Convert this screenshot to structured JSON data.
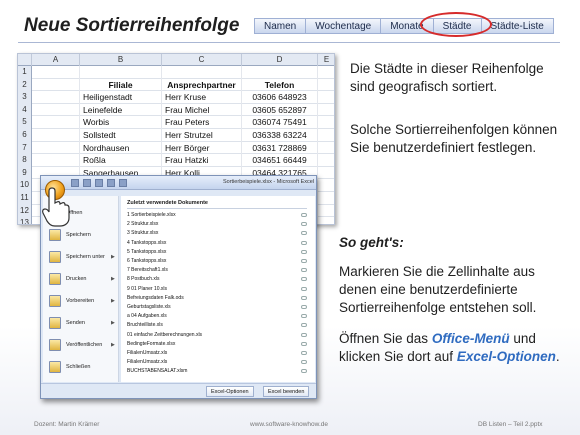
{
  "title": "Neue Sortierreihenfolge",
  "nav_tabs": [
    "Namen",
    "Wochentage",
    "Monate",
    "Städte",
    "Städte-Liste"
  ],
  "sheet": {
    "columns": [
      "A",
      "B",
      "C",
      "D",
      "E"
    ],
    "row_numbers": [
      "1",
      "2",
      "3",
      "4",
      "5",
      "6",
      "7",
      "8",
      "9",
      "10",
      "11",
      "12",
      "13"
    ],
    "header": {
      "filiale": "Filiale",
      "ansprechpartner": "Ansprechpartner",
      "telefon": "Telefon"
    },
    "rows": [
      {
        "filiale": "Heiligenstadt",
        "partner": "Herr Kruse",
        "telefon": "03606 648923"
      },
      {
        "filiale": "Leinefelde",
        "partner": "Frau Michel",
        "telefon": "03605 652897"
      },
      {
        "filiale": "Worbis",
        "partner": "Frau Peters",
        "telefon": "036074 75491"
      },
      {
        "filiale": "Sollstedt",
        "partner": "Herr Strutzel",
        "telefon": "036338 63224"
      },
      {
        "filiale": "Nordhausen",
        "partner": "Herr Börger",
        "telefon": "03631 728869"
      },
      {
        "filiale": "Roßla",
        "partner": "Frau Hatzki",
        "telefon": "034651 66449"
      },
      {
        "filiale": "Sangerhausen",
        "partner": "Herr Kolli",
        "telefon": "03464 321765"
      }
    ]
  },
  "office": {
    "window_title": "Sortierbeispiele.xlsx - Microsoft Excel",
    "menu_items": [
      {
        "label": "Öffnen",
        "arrow": ""
      },
      {
        "label": "Speichern",
        "arrow": ""
      },
      {
        "label": "Speichern unter",
        "arrow": "▶"
      },
      {
        "label": "Drucken",
        "arrow": "▶"
      },
      {
        "label": "Vorbereiten",
        "arrow": "▶"
      },
      {
        "label": "Senden",
        "arrow": "▶"
      },
      {
        "label": "Veröffentlichen",
        "arrow": "▶"
      },
      {
        "label": "Schließen",
        "arrow": ""
      }
    ],
    "recent_title": "Zuletzt verwendete Dokumente",
    "recent_docs": [
      "1 Sortierbeispiele.xlsx",
      "2 Struktur.xlsx",
      "3 Struktur.xlsx",
      "4 Tankstopps.xlsx",
      "5 Tankstopps.xlsx",
      "6 Tankstopps.xlsx",
      "7 Bereitschaft1.xls",
      "8 Postbuch.xls",
      "9 01 Planer 10.xls",
      "Befreiungsdaten Falk.ods",
      "Geburtstagsliste.xls",
      "a 04 Aufgaben.xls",
      "Bruchteilliste.xls",
      "01 einfache Zeitberechnungen.xls",
      "BedingteFormate.xlsx",
      "FilialenUmsatz.xls",
      "FilialenUmsatz.xls",
      "BUCHSTABENSALAT.xlsm"
    ],
    "options_btn": "Excel-Optionen",
    "exit_btn": "Excel beenden"
  },
  "text": {
    "p1": "Die Städte in dieser Reihenfolge sind geografisch sortiert.",
    "p2": "Solche Sortierreihenfolgen können Sie benutzerdefiniert festlegen.",
    "sogehts": "So geht's:",
    "p3": "Markieren Sie die Zellinhalte aus denen eine benutzerdefinierte Sortierreihenfolge entstehen soll.",
    "p4_a": "Öffnen Sie das ",
    "p4_office": "Office-Menü",
    "p4_b": " und klicken Sie dort auf ",
    "p4_excel": "Excel-Optionen",
    "p4_c": "."
  },
  "footer": {
    "left": "Dozent: Martin Krämer",
    "center": "www.software-knowhow.de",
    "right": "DB Listen – Teil 2.pptx"
  },
  "colors": {
    "accent_link": "#2f6bc0",
    "highlight_ellipse": "#d62b2b"
  }
}
